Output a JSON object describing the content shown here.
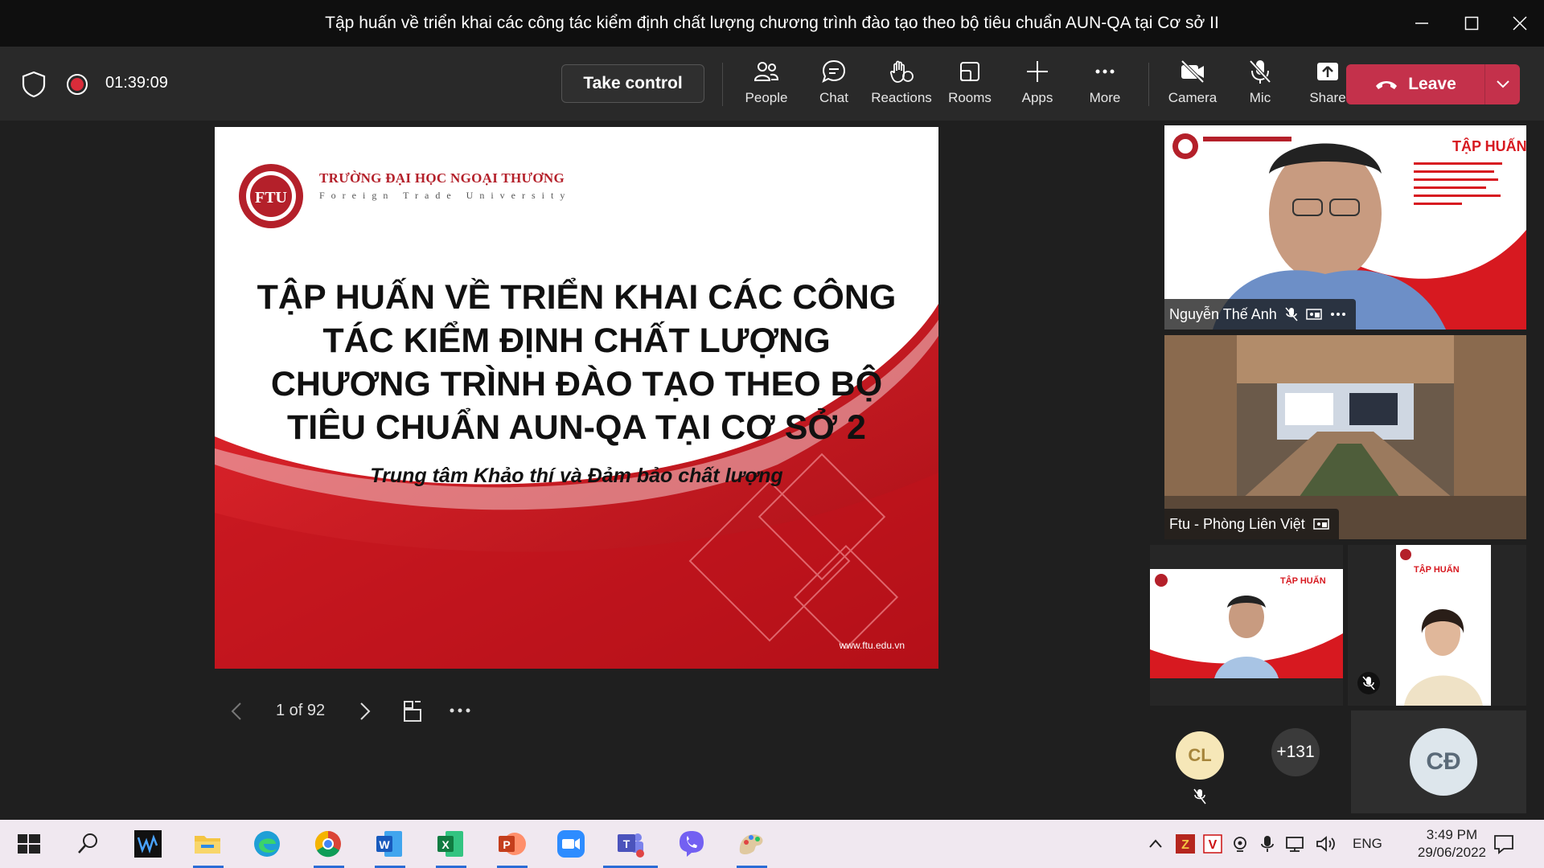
{
  "window": {
    "title": "Tập huấn về triển khai các công tác kiểm định chất lượng chương trình đào tạo theo bộ tiêu chuẩn AUN-QA tại Cơ sở II"
  },
  "meeting_bar": {
    "timer": "01:39:09",
    "take_control": "Take control",
    "items": [
      {
        "label": "People",
        "icon": "people-icon"
      },
      {
        "label": "Chat",
        "icon": "chat-icon"
      },
      {
        "label": "Reactions",
        "icon": "reactions-icon"
      },
      {
        "label": "Rooms",
        "icon": "rooms-icon"
      },
      {
        "label": "Apps",
        "icon": "apps-icon"
      },
      {
        "label": "More",
        "icon": "more-icon"
      },
      {
        "label": "Camera",
        "icon": "camera-off-icon"
      },
      {
        "label": "Mic",
        "icon": "mic-off-icon"
      },
      {
        "label": "Share",
        "icon": "share-icon"
      }
    ],
    "leave": "Leave"
  },
  "slide": {
    "university_name": "TRƯỜNG ĐẠI HỌC NGOẠI THƯƠNG",
    "university_en": "Foreign Trade University",
    "headline": "TẬP HUẤN VỀ TRIỂN KHAI CÁC CÔNG TÁC KIỂM ĐỊNH CHẤT LƯỢNG CHƯƠNG TRÌNH ĐÀO TẠO THEO BỘ TIÊU CHUẨN AUN-QA TẠI CƠ SỞ 2",
    "subline": "Trung tâm Khảo thí và Đảm bảo chất lượng",
    "url": "www.ftu.edu.vn",
    "page_indicator": "1 of 92"
  },
  "participants": {
    "tile1_name": "Nguyễn Thế Anh",
    "tile2_name": "Ftu - Phòng Liên Việt",
    "avatar_cl": "CL",
    "overflow_count": "+131",
    "avatar_cd": "CĐ",
    "thumb_title": "TẬP HUẤN"
  },
  "taskbar": {
    "time": "3:49 PM",
    "date": "29/06/2022",
    "lang": "ENG"
  },
  "colors": {
    "leave_red": "#c4314b",
    "slide_red": "#d71920",
    "meeting_bar": "#292929"
  }
}
